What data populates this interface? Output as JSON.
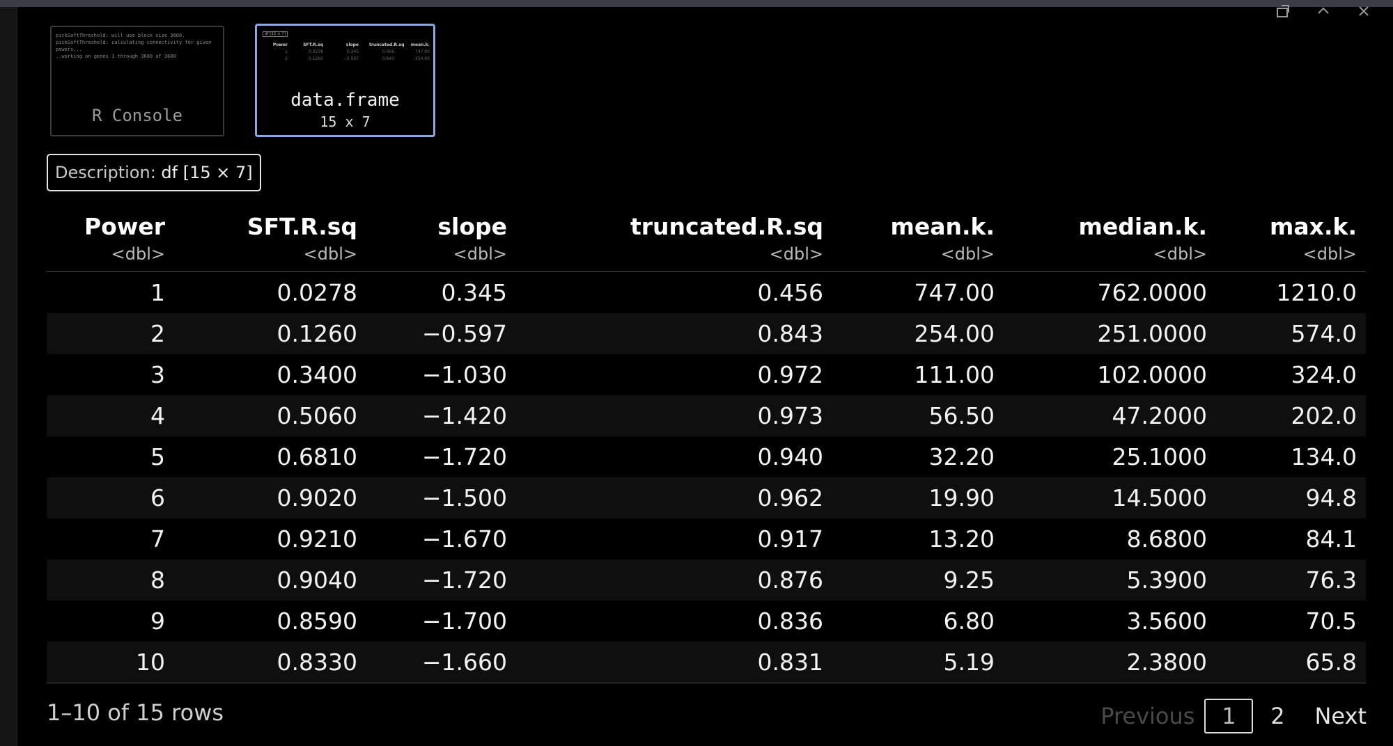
{
  "thumbnails": {
    "console": {
      "label": "R Console",
      "lines": [
        "pickSoftThreshold: will use block size 3600.",
        " pickSoftThreshold: calculating connectivity for given",
        "powers...",
        "   ..working on genes 1 through 3600 of 3600"
      ]
    },
    "dataframe": {
      "label": "data.frame",
      "dims": "15 x 7"
    }
  },
  "description": {
    "label": "Description:",
    "value": "df [15 × 7]"
  },
  "table": {
    "columns": [
      {
        "name": "Power",
        "type": "<dbl>"
      },
      {
        "name": "SFT.R.sq",
        "type": "<dbl>"
      },
      {
        "name": "slope",
        "type": "<dbl>"
      },
      {
        "name": "truncated.R.sq",
        "type": "<dbl>"
      },
      {
        "name": "mean.k.",
        "type": "<dbl>"
      },
      {
        "name": "median.k.",
        "type": "<dbl>"
      },
      {
        "name": "max.k.",
        "type": "<dbl>"
      }
    ],
    "rows": [
      [
        "1",
        "0.0278",
        "0.345",
        "0.456",
        "747.00",
        "762.0000",
        "1210.0"
      ],
      [
        "2",
        "0.1260",
        "−0.597",
        "0.843",
        "254.00",
        "251.0000",
        "574.0"
      ],
      [
        "3",
        "0.3400",
        "−1.030",
        "0.972",
        "111.00",
        "102.0000",
        "324.0"
      ],
      [
        "4",
        "0.5060",
        "−1.420",
        "0.973",
        "56.50",
        "47.2000",
        "202.0"
      ],
      [
        "5",
        "0.6810",
        "−1.720",
        "0.940",
        "32.20",
        "25.1000",
        "134.0"
      ],
      [
        "6",
        "0.9020",
        "−1.500",
        "0.962",
        "19.90",
        "14.5000",
        "94.8"
      ],
      [
        "7",
        "0.9210",
        "−1.670",
        "0.917",
        "13.20",
        "8.6800",
        "84.1"
      ],
      [
        "8",
        "0.9040",
        "−1.720",
        "0.876",
        "9.25",
        "5.3900",
        "76.3"
      ],
      [
        "9",
        "0.8590",
        "−1.700",
        "0.836",
        "6.80",
        "3.5600",
        "70.5"
      ],
      [
        "10",
        "0.8330",
        "−1.660",
        "0.831",
        "5.19",
        "2.3800",
        "65.8"
      ]
    ]
  },
  "footer": {
    "rows_info": "1–10 of 15 rows",
    "previous": "Previous",
    "pages": [
      "1",
      "2"
    ],
    "current_page": "1",
    "next": "Next"
  },
  "window_controls": [
    "pop-out-icon",
    "collapse-icon",
    "close-icon"
  ]
}
